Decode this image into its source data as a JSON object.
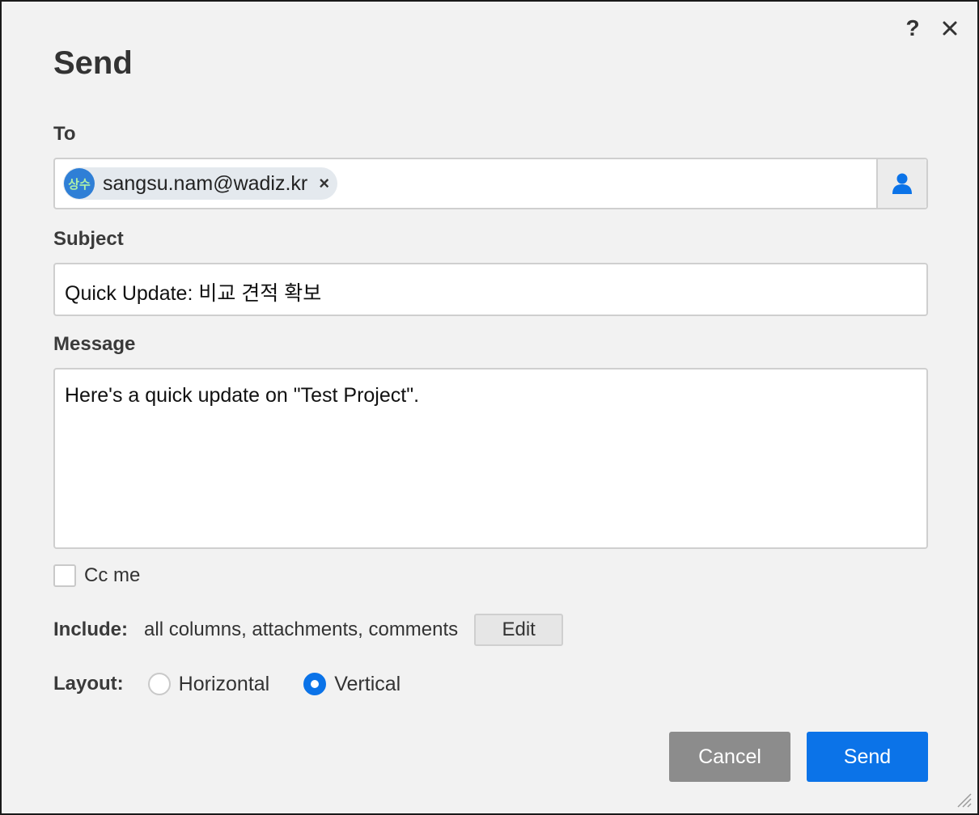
{
  "dialog": {
    "title": "Send",
    "help_glyph": "?",
    "close_icon": "close-icon"
  },
  "to": {
    "label": "To",
    "recipients": [
      {
        "avatar_text": "상수",
        "email": "sangsu.nam@wadiz.kr",
        "avatar_color": "#2f7fd6"
      }
    ],
    "remove_glyph": "×",
    "contacts_icon": "person-icon"
  },
  "subject": {
    "label": "Subject",
    "value": "Quick Update: 비교 견적 확보"
  },
  "message": {
    "label": "Message",
    "value": "Here's a quick update on \"Test Project\"."
  },
  "cc_me": {
    "label": "Cc me",
    "checked": false
  },
  "include": {
    "label": "Include:",
    "value": "all columns, attachments, comments",
    "edit_label": "Edit"
  },
  "layout": {
    "label": "Layout:",
    "options": [
      {
        "label": "Horizontal",
        "selected": false
      },
      {
        "label": "Vertical",
        "selected": true
      }
    ]
  },
  "buttons": {
    "cancel_label": "Cancel",
    "send_label": "Send"
  },
  "colors": {
    "accent": "#0b73e8",
    "cancel": "#8c8c8c",
    "dialog_bg": "#f2f2f2"
  }
}
